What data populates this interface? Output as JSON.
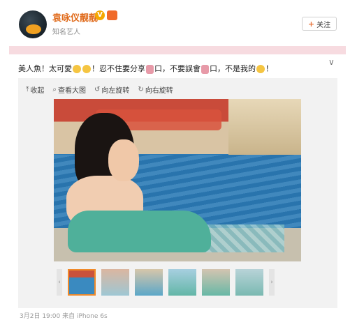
{
  "header": {
    "name": "袁咏仪靓靓",
    "verified_badge": "V",
    "subtitle": "知名艺人",
    "follow_label": "关注",
    "follow_icon": "plus-icon"
  },
  "post": {
    "text_parts": [
      "美人魚！太可愛",
      "！忍不住要分享",
      "口，不要誤會",
      "口，不是我的",
      "！"
    ]
  },
  "toolbar": {
    "collapse_label": "收起",
    "view_large_label": "查看大图",
    "rotate_left_label": "向左旋转",
    "rotate_right_label": "向右旋转"
  },
  "thumbnails": {
    "count": 6,
    "selected_index": 0
  },
  "footer": {
    "text": "3月2日 19:00 来自 iPhone 6s"
  },
  "colors": {
    "name": "#e06a1a",
    "accent": "#f08a2a",
    "banner": "#f7dbe0"
  }
}
